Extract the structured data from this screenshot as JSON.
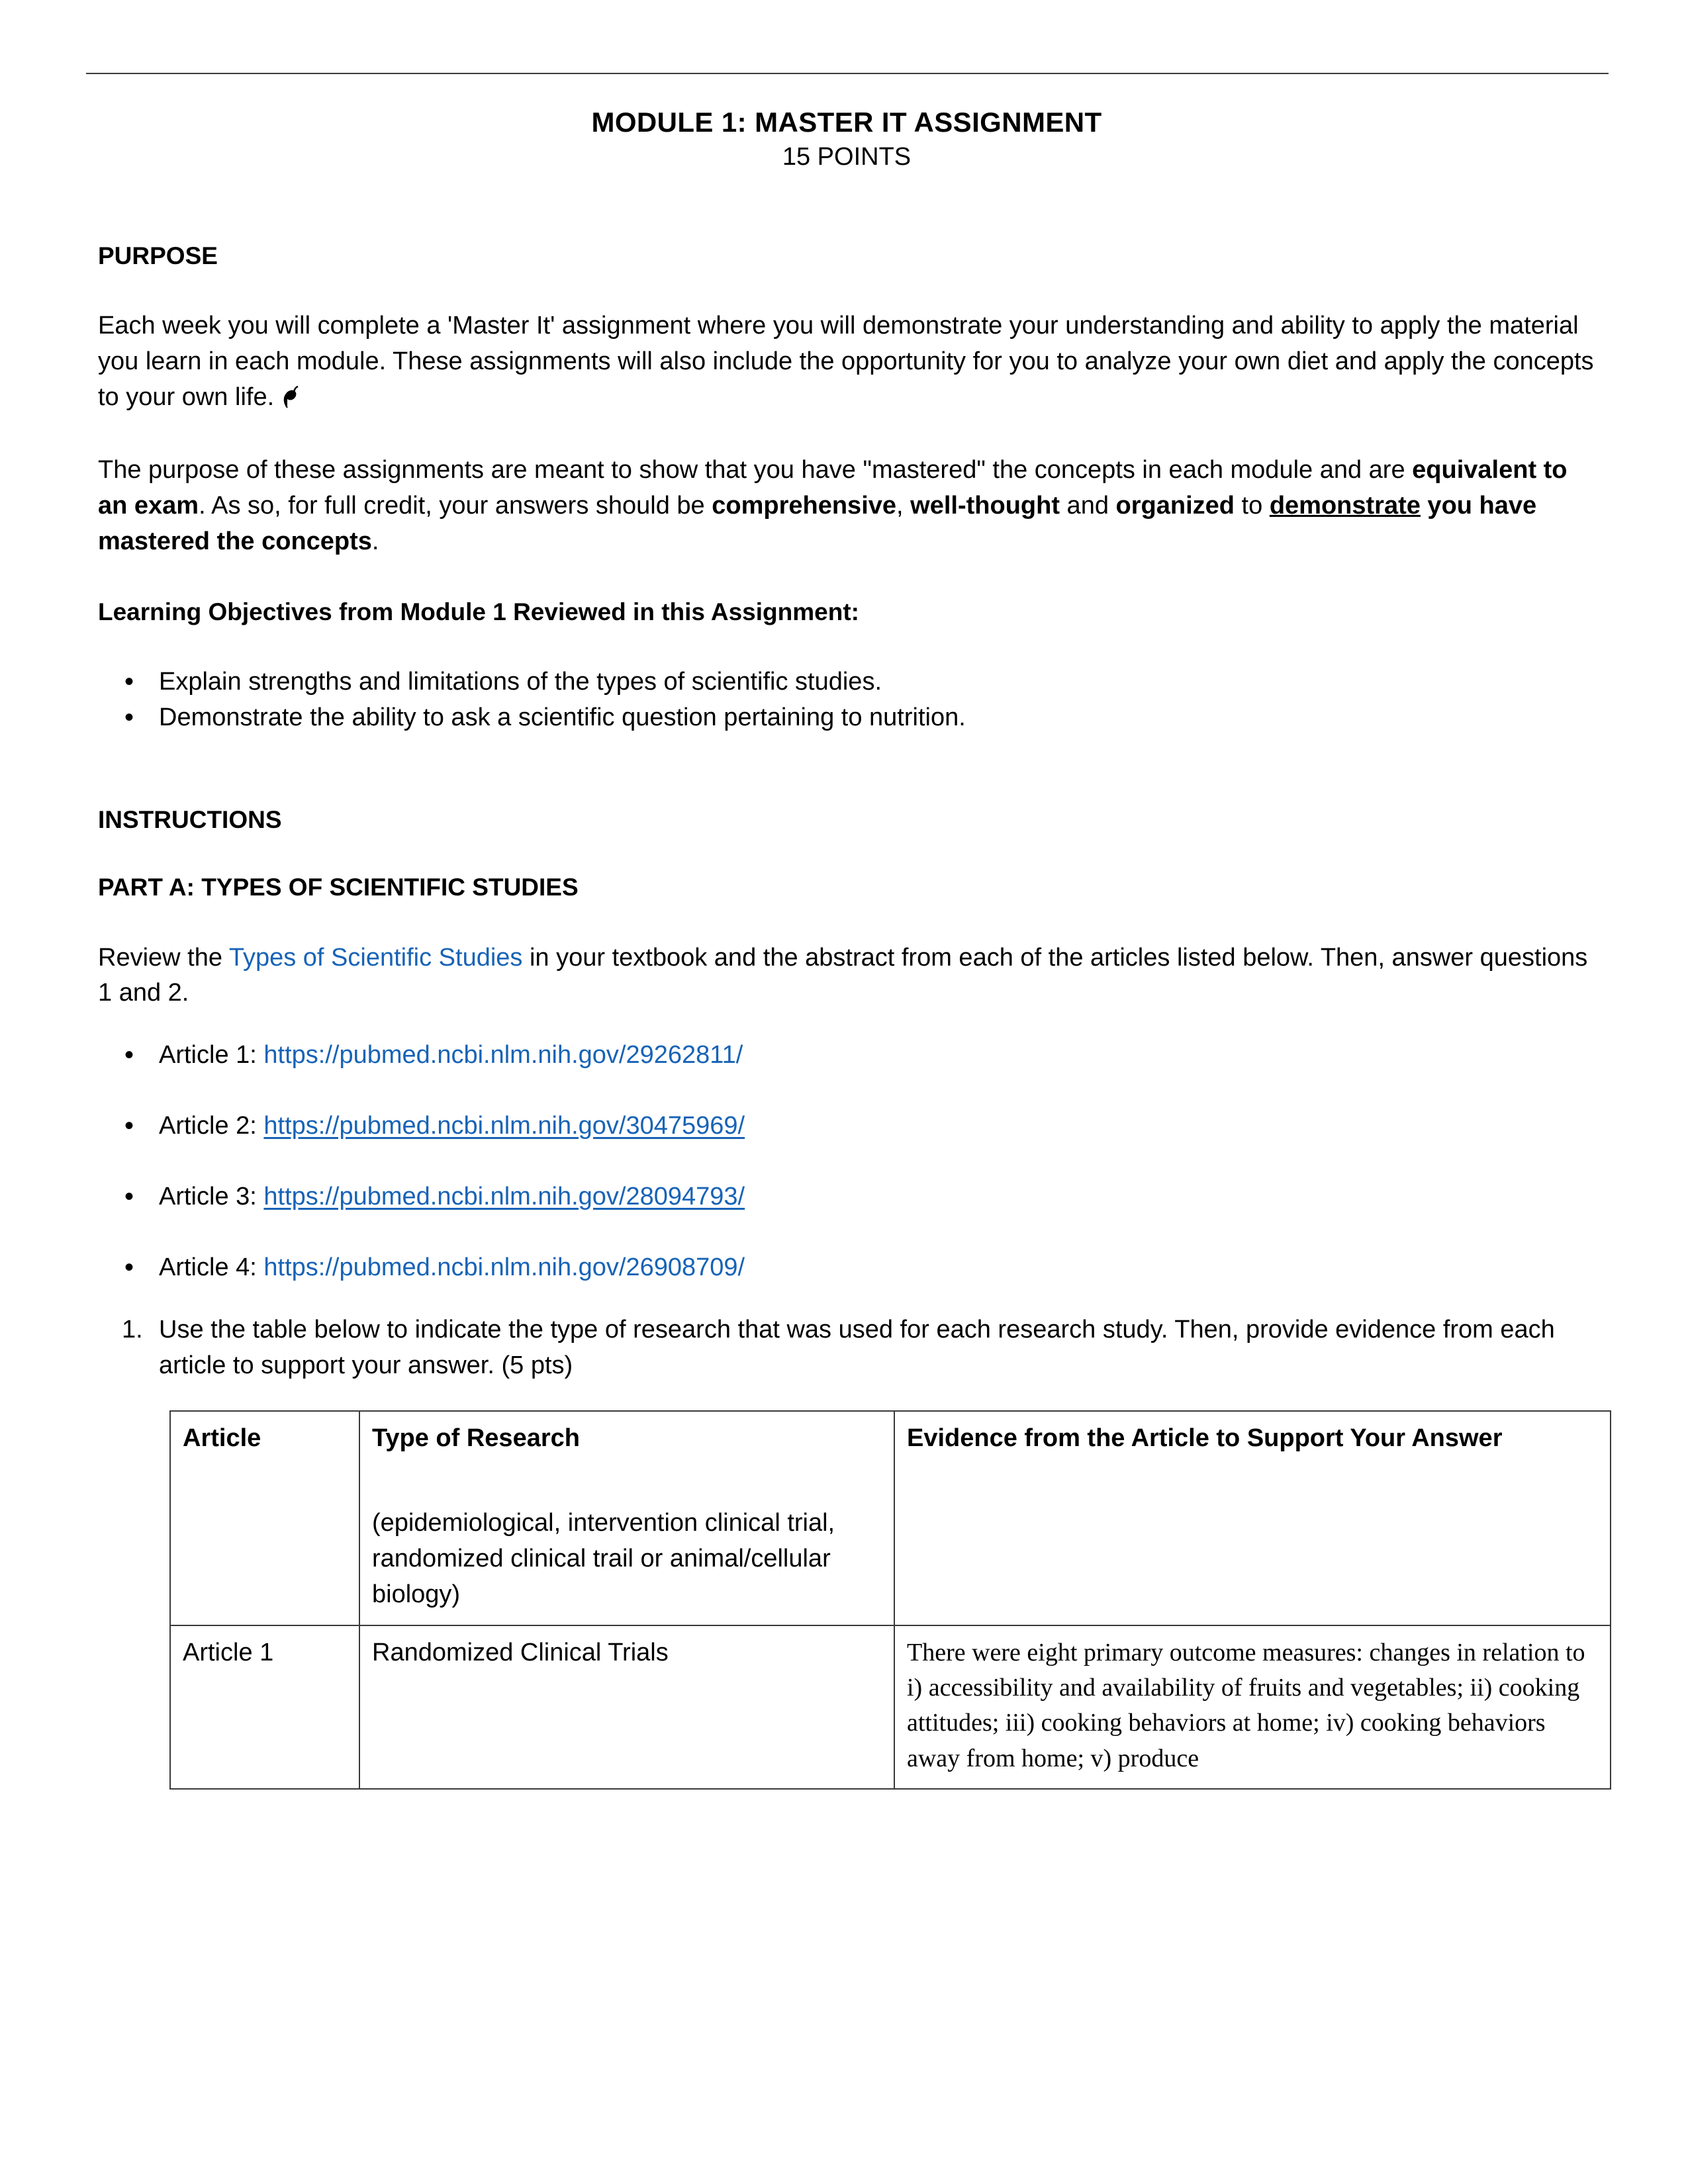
{
  "document": {
    "title": "MODULE 1: MASTER IT ASSIGNMENT",
    "subtitle": "15 POINTS"
  },
  "purpose": {
    "heading": "PURPOSE",
    "paragraph1_part1": "Each week you will complete a 'Master It' assignment where you will demonstrate your understanding and ability to apply the material you learn in each module. These assignments will also include the opportunity for you to analyze your own diet and apply the concepts to your own life.",
    "paragraph2_segments": {
      "s1": "The purpose of these assignments are meant to show that you have \"mastered\" the concepts in each module and are ",
      "s2_bold": "equivalent to an exam",
      "s3": ". As so, for full credit, your answers should be ",
      "s4_bold": "comprehensive",
      "s5": ", ",
      "s6_bold": "well-thought",
      "s7": " and ",
      "s8_bold": "organized",
      "s9": " to ",
      "s10_bold_underline": "demonstrate",
      "s11_bold": " you have mastered the concepts",
      "s12": "."
    }
  },
  "objectives": {
    "heading": "Learning Objectives from Module 1 Reviewed in this Assignment:",
    "items": [
      "Explain strengths and limitations of the types of scientific studies.",
      "Demonstrate the ability to ask a scientific question pertaining to nutrition."
    ]
  },
  "instructions": {
    "heading": "INSTRUCTIONS",
    "part_a_heading": "PART A: TYPES OF SCIENTIFIC STUDIES",
    "review_prefix": "Review the ",
    "review_link": "Types of Scientific Studies",
    "review_suffix": " in your textbook and the abstract from each of the articles listed below. Then, answer questions 1 and 2.",
    "articles": [
      {
        "label": "Article 1: ",
        "url": "https://pubmed.ncbi.nlm.nih.gov/29262811/"
      },
      {
        "label": "Article 2: ",
        "url": "https://pubmed.ncbi.nlm.nih.gov/30475969/"
      },
      {
        "label": "Article 3: ",
        "url": "https://pubmed.ncbi.nlm.nih.gov/28094793/"
      },
      {
        "label": "Article 4: ",
        "url": "https://pubmed.ncbi.nlm.nih.gov/26908709/"
      }
    ],
    "question1": "Use the table below to indicate the type of research that was used for each research study. Then, provide evidence from each article to support your answer. (5 pts)"
  },
  "table": {
    "headers": {
      "article": "Article",
      "type_of_research": "Type of Research",
      "type_of_research_note": "(epidemiological, intervention clinical trial, randomized clinical trail or animal/cellular biology)",
      "evidence": "Evidence from the Article to Support Your Answer"
    },
    "rows": [
      {
        "article": "Article 1",
        "type": "Randomized Clinical Trials",
        "evidence": "There were eight primary outcome measures: changes in relation to i) accessibility and availability of fruits and vegetables; ii) cooking attitudes; iii) cooking behaviors at home; iv) cooking behaviors away from home; v) produce"
      }
    ]
  },
  "colors": {
    "link": "#1763B6",
    "rule": "#3a3a3a",
    "text": "#000000"
  }
}
